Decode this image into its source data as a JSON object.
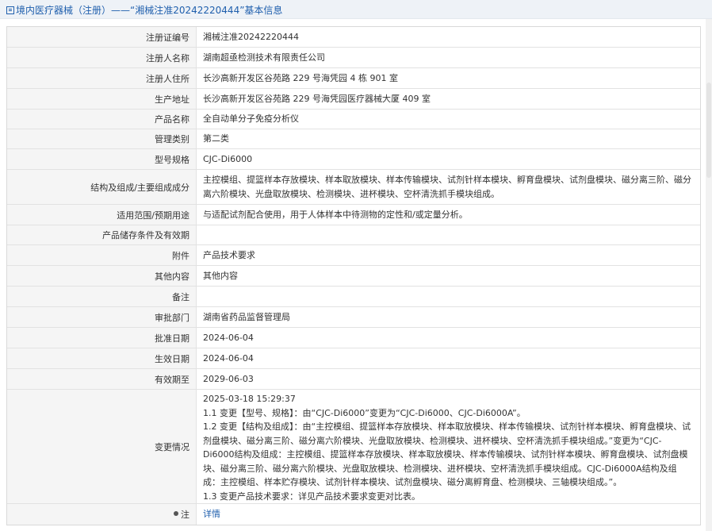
{
  "header": {
    "title": "境内医疗器械（注册）——“湘械注准20242220444”基本信息"
  },
  "fields": [
    {
      "label": "注册证编号",
      "value": "湘械注准20242220444"
    },
    {
      "label": "注册人名称",
      "value": "湖南超亟检测技术有限责任公司"
    },
    {
      "label": "注册人住所",
      "value": "长沙高新开发区谷苑路 229 号海凭园 4 栋 901 室"
    },
    {
      "label": "生产地址",
      "value": "长沙高新开发区谷苑路 229 号海凭园医疗器械大厦 409 室"
    },
    {
      "label": "产品名称",
      "value": "全自动单分子免疫分析仪"
    },
    {
      "label": "管理类别",
      "value": "第二类"
    },
    {
      "label": "型号规格",
      "value": "CJC-Di6000"
    },
    {
      "label": "结构及组成/主要组成成分",
      "value": "主控模组、提篮样本存放模块、样本取放模块、样本传输模块、试剂针样本模块、孵育盘模块、试剂盘模块、磁分离三阶、磁分离六阶模块、光盘取放模块、检测模块、进杯模块、空杯清洗抓手模块组成。"
    },
    {
      "label": "适用范围/预期用途",
      "value": "与适配试剂配合使用，用于人体样本中待测物的定性和/或定量分析。"
    },
    {
      "label": "产品储存条件及有效期",
      "value": ""
    },
    {
      "label": "附件",
      "value": "产品技术要求"
    },
    {
      "label": "其他内容",
      "value": "其他内容"
    },
    {
      "label": "备注",
      "value": ""
    },
    {
      "label": "审批部门",
      "value": "湖南省药品监督管理局"
    },
    {
      "label": "批准日期",
      "value": "2024-06-04"
    },
    {
      "label": "生效日期",
      "value": "2024-06-04"
    },
    {
      "label": "有效期至",
      "value": "2029-06-03"
    }
  ],
  "change": {
    "label": "变更情况",
    "lines": [
      "2025-03-18 15:29:37",
      "1.1 变更【型号、规格】：由“CJC-Di6000”变更为“CJC-Di6000、CJC-Di6000A”。",
      "1.2 变更【结构及组成】：由“主控模组、提篮样本存放模块、样本取放模块、样本传输模块、试剂针样本模块、孵育盘模块、试剂盘模块、磁分离三阶、磁分离六阶模块、光盘取放模块、检测模块、进杯模块、空杯清洗抓手模块组成。”变更为“CJC-Di6000结构及组成：主控模组、提篮样本存放模块、样本取放模块、样本传输模块、试剂针样本模块、孵育盘模块、试剂盘模块、磁分离三阶、磁分离六阶模块、光盘取放模块、检测模块、进杯模块、空杯清洗抓手模块组成。CJC-Di6000A结构及组成：主控模组、样本贮存模块、试剂针样本模块、试剂盘模块、磁分离孵育盘、检测模块、三轴模块组成。”。",
      "1.3 变更产品技术要求：详见产品技术要求变更对比表。"
    ]
  },
  "note": {
    "label": "注",
    "link": "详情"
  }
}
